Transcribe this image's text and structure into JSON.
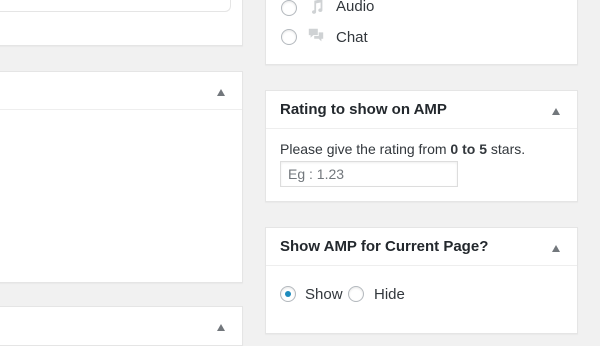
{
  "post_formats": {
    "options": [
      {
        "label": "Audio",
        "icon": "audio-icon",
        "selected": false
      },
      {
        "label": "Chat",
        "icon": "chat-icon",
        "selected": false
      }
    ]
  },
  "rating_box": {
    "title": "Rating to show on AMP",
    "help_prefix": "Please give the rating from ",
    "help_range": "0 to 5",
    "help_suffix": " stars.",
    "input_placeholder": "Eg : 1.23",
    "input_value": ""
  },
  "show_amp_box": {
    "title": "Show AMP for Current Page?",
    "options": [
      {
        "label": "Show",
        "selected": true
      },
      {
        "label": "Hide",
        "selected": false
      }
    ]
  },
  "colors": {
    "accent": "#1e8cbe",
    "background": "#f1f1f1",
    "panel": "#ffffff"
  }
}
